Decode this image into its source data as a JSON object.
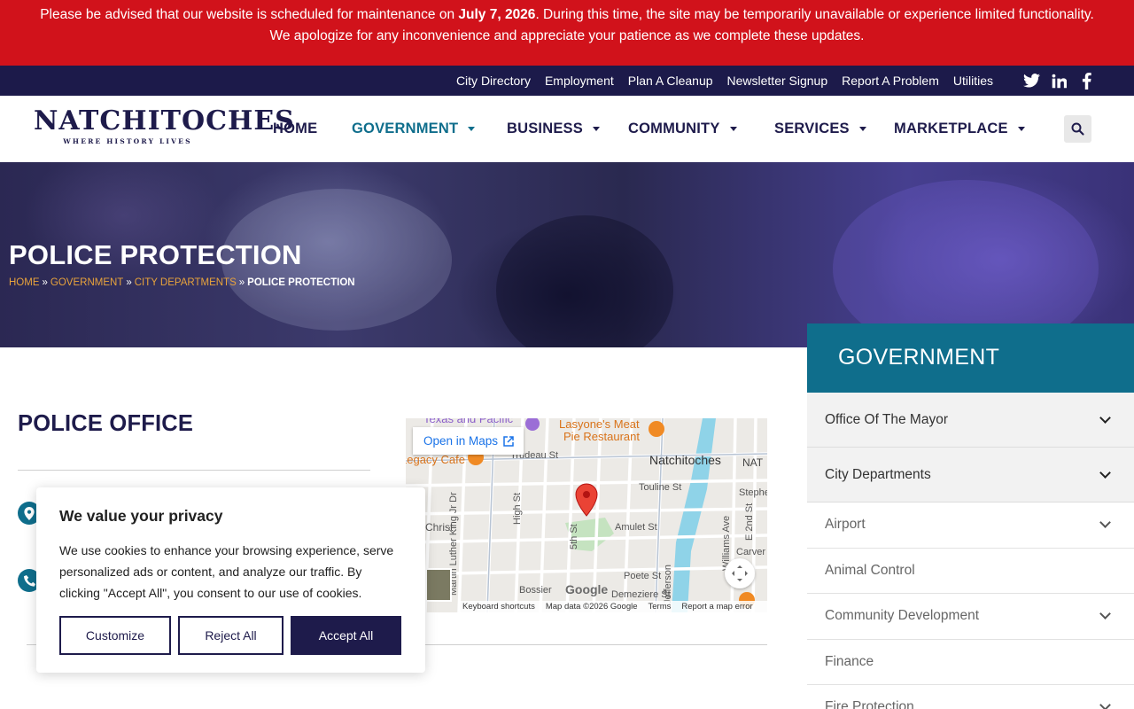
{
  "alert": {
    "line1_pre": "Please be advised that our website is scheduled for maintenance on ",
    "line1_date": "July 7, 2026",
    "line1_post": ". During this time, the site may be temporarily unavailable or experience limited functionality.",
    "line2": "We apologize for any inconvenience and appreciate your patience as we complete these updates."
  },
  "utility": {
    "links": [
      "City Directory",
      "Employment",
      "Plan A Cleanup",
      "Newsletter Signup",
      "Report A Problem",
      "Utilities"
    ],
    "social_icons": [
      "twitter-icon",
      "linkedin-icon",
      "facebook-icon"
    ]
  },
  "logo": {
    "word": "NATCHITOCHES",
    "tagline": "WHERE HISTORY LIVES"
  },
  "nav": {
    "items": [
      {
        "label": "HOME"
      },
      {
        "label": "GOVERNMENT"
      },
      {
        "label": "BUSINESS"
      },
      {
        "label": "COMMUNITY"
      },
      {
        "label": "SERVICES"
      },
      {
        "label": "MARKETPLACE"
      }
    ],
    "active": "GOVERNMENT",
    "search_icon": "search-icon"
  },
  "hero": {
    "title": "POLICE PROTECTION",
    "breadcrumbs": [
      "HOME",
      "GOVERNMENT",
      "CITY DEPARTMENTS"
    ],
    "breadcrumb_sep": "»",
    "current": "POLICE PROTECTION"
  },
  "main": {
    "office_title": "POLICE OFFICE",
    "icons": [
      "location-pin-icon",
      "phone-icon"
    ]
  },
  "map": {
    "open_label": "Open in Maps",
    "labels": [
      "Texas and Pacific",
      "Lasyone's Meat",
      "Pie Restaurant",
      "Natchitoches",
      "NAT",
      "Legacy Cafe",
      "Trudeau St",
      "Touline St",
      "Stephe",
      "Christ",
      "Martin Luther King Jr Dr",
      "High St",
      "5th St",
      "Amulet St",
      "Williams Ave",
      "E 2nd St",
      "Carver",
      "Poete St",
      "Jefferson",
      "Bossier",
      "Demeziere St"
    ],
    "footer": [
      "Keyboard shortcuts",
      "Map data ©2026 Google",
      "Terms",
      "Report a map error"
    ],
    "brand": "Google"
  },
  "sidebar": {
    "title": "GOVERNMENT",
    "items": [
      {
        "label": "Office Of The Mayor",
        "expandable": true
      },
      {
        "label": "City Departments",
        "expandable": true
      },
      {
        "label": "Airport",
        "expandable": true
      },
      {
        "label": "Animal Control",
        "expandable": false
      },
      {
        "label": "Community Development",
        "expandable": true
      },
      {
        "label": "Finance",
        "expandable": false
      },
      {
        "label": "Fire Protection",
        "expandable": true
      }
    ]
  },
  "cookie": {
    "title": "We value your privacy",
    "text": "We use cookies to enhance your browsing experience, serve personalized ads or content, and analyze our traffic. By clicking \"Accept All\", you consent to our use of cookies.",
    "customize": "Customize",
    "reject": "Reject All",
    "accept": "Accept All"
  },
  "colors": {
    "alert_red": "#d1121b",
    "navy": "#1c1a4a",
    "teal": "#0f6e8c",
    "breadcrumb_orange": "#e8a33c"
  }
}
